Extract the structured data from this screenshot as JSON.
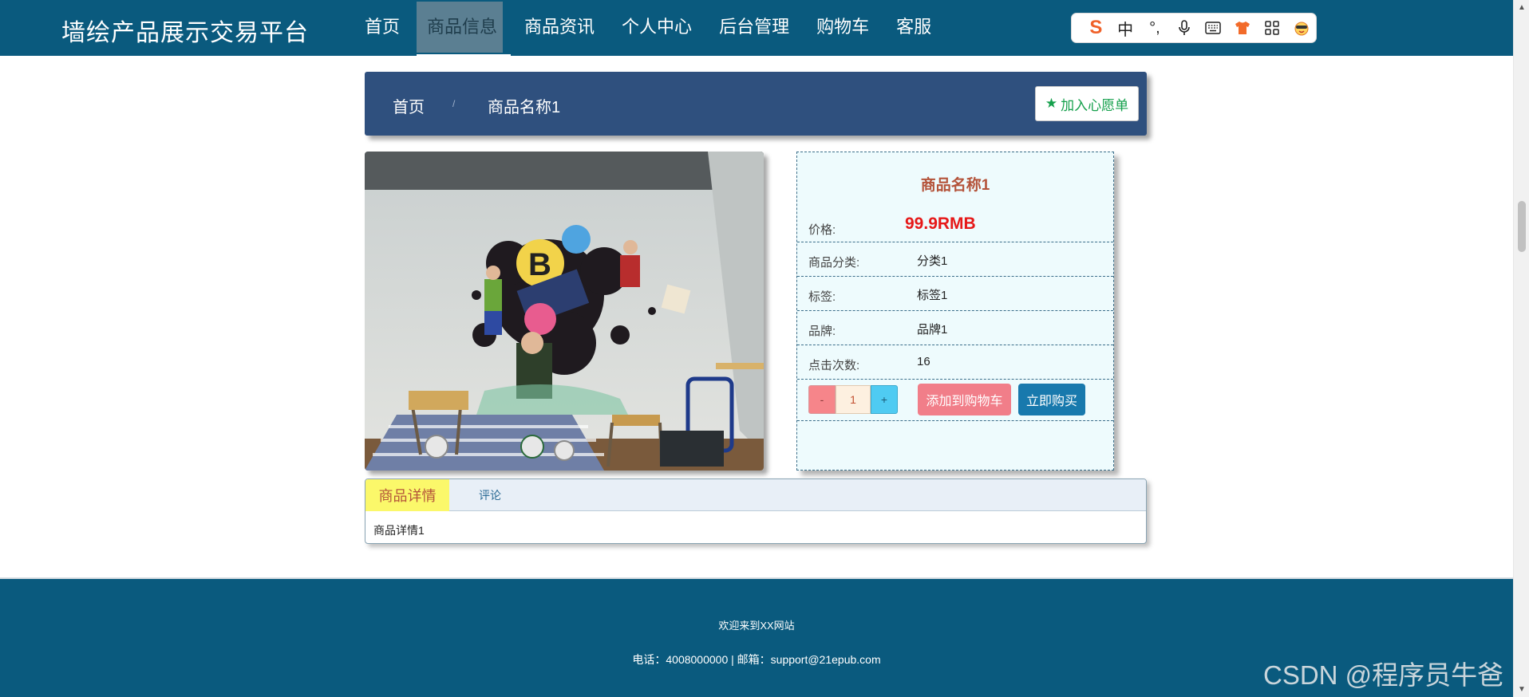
{
  "header": {
    "site_title": "墙绘产品展示交易平台",
    "nav": [
      {
        "label": "首页"
      },
      {
        "label": "商品信息"
      },
      {
        "label": "商品资讯"
      },
      {
        "label": "个人中心"
      },
      {
        "label": "后台管理"
      },
      {
        "label": "购物车"
      },
      {
        "label": "客服"
      }
    ],
    "active_nav": "商品信息",
    "ime_toolbar": {
      "mode_label": "中",
      "punctuation": "°,",
      "icons": [
        "sogou-logo-icon",
        "punctuation-icon",
        "microphone-icon",
        "keyboard-icon",
        "skin-icon",
        "toolbox-icon",
        "emoji-icon"
      ]
    }
  },
  "breadcrumb": {
    "home": "首页",
    "separator": "/",
    "current": "商品名称1",
    "wishlist_label": "加入心愿单"
  },
  "product": {
    "name": "商品名称1",
    "rows": [
      {
        "label": "价格:",
        "value": "99.9RMB"
      },
      {
        "label": "商品分类:",
        "value": "分类1"
      },
      {
        "label": "标签:",
        "value": "标签1"
      },
      {
        "label": "品牌:",
        "value": "品牌1"
      },
      {
        "label": "点击次数:",
        "value": "16"
      }
    ],
    "quantity": {
      "minus": "-",
      "value": "1",
      "plus": "+"
    },
    "add_to_cart": "添加到购物车",
    "buy_now": "立即购买"
  },
  "tabs": {
    "items": [
      {
        "label": "商品详情"
      },
      {
        "label": "评论"
      }
    ],
    "active": "商品详情",
    "content": "商品详情1"
  },
  "footer": {
    "welcome": "欢迎来到XX网站",
    "contact": "电话：4008000000 | 邮箱：support@21epub.com"
  },
  "watermark": "CSDN @程序员牛爸",
  "colors": {
    "header_bg": "#0a5a7e",
    "breadcrumb_bg": "#2f507e",
    "price": "#e61818",
    "product_name": "#b4533a",
    "cart_button": "#f17e89",
    "buy_button": "#1879ad",
    "active_tab": "#fbf86a"
  }
}
